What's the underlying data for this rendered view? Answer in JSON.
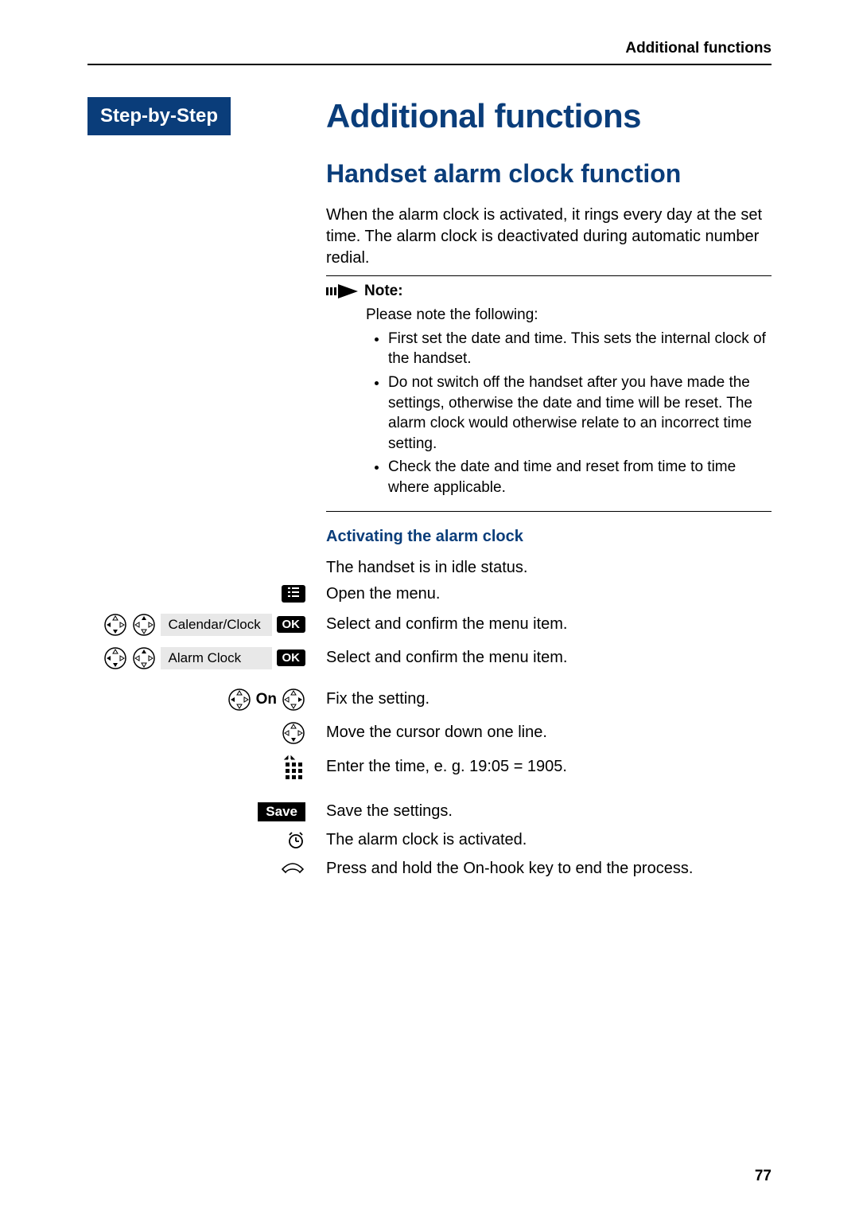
{
  "running_header": "Additional functions",
  "sidebar_title": "Step-by-Step",
  "title": "Additional functions",
  "section_title": "Handset alarm clock function",
  "intro_text": "When the alarm clock is activated, it rings every day at the set time. The alarm clock is deactivated during automatic number redial.",
  "note": {
    "label": "Note:",
    "lead": "Please note the following:",
    "items": [
      "First set the date and time. This sets the internal clock of the handset.",
      "Do not switch off the handset after you have made the settings, otherwise the date and time will be reset. The alarm clock would otherwise relate to an incorrect time setting.",
      "Check the date and time and reset from time to time where applicable."
    ]
  },
  "subsection_title": "Activating the alarm clock",
  "idle_text": "The handset is in idle status.",
  "steps": [
    {
      "left_menu_label": "",
      "right_text": "Open the menu.",
      "btn": "menu"
    },
    {
      "left_menu_label": "Calendar/Clock",
      "right_text": "Select and confirm the menu item.",
      "btn": "ok"
    },
    {
      "left_menu_label": "Alarm Clock",
      "right_text": "Select and confirm the menu item.",
      "btn": "ok"
    },
    {
      "on_label": "On",
      "right_text": "Fix the setting."
    },
    {
      "right_text": "Move the cursor down one line."
    },
    {
      "right_text": "Enter the time, e. g. 19:05 = 1905."
    },
    {
      "save_label": "Save",
      "right_text": "Save the settings."
    },
    {
      "right_text": "The alarm clock is activated."
    },
    {
      "right_text": "Press and hold the On-hook key to end the process."
    }
  ],
  "ok_label": "OK",
  "page_number": "77"
}
